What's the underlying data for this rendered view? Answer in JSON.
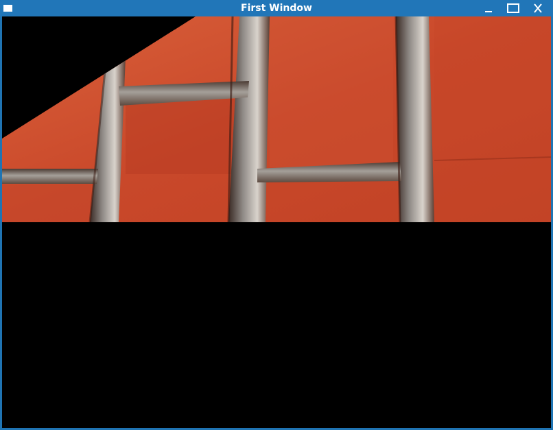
{
  "window": {
    "title": "First Window",
    "titlebar_color": "#2176b8",
    "client_background": "#000000"
  },
  "controls": {
    "minimize_icon": "minimize-icon",
    "maximize_icon": "maximize-icon",
    "close_icon": "close-icon"
  },
  "scene": {
    "texture": "red-brick-texture",
    "brick_color": "#c8482a",
    "mortar_color": "#9a9a9a"
  }
}
